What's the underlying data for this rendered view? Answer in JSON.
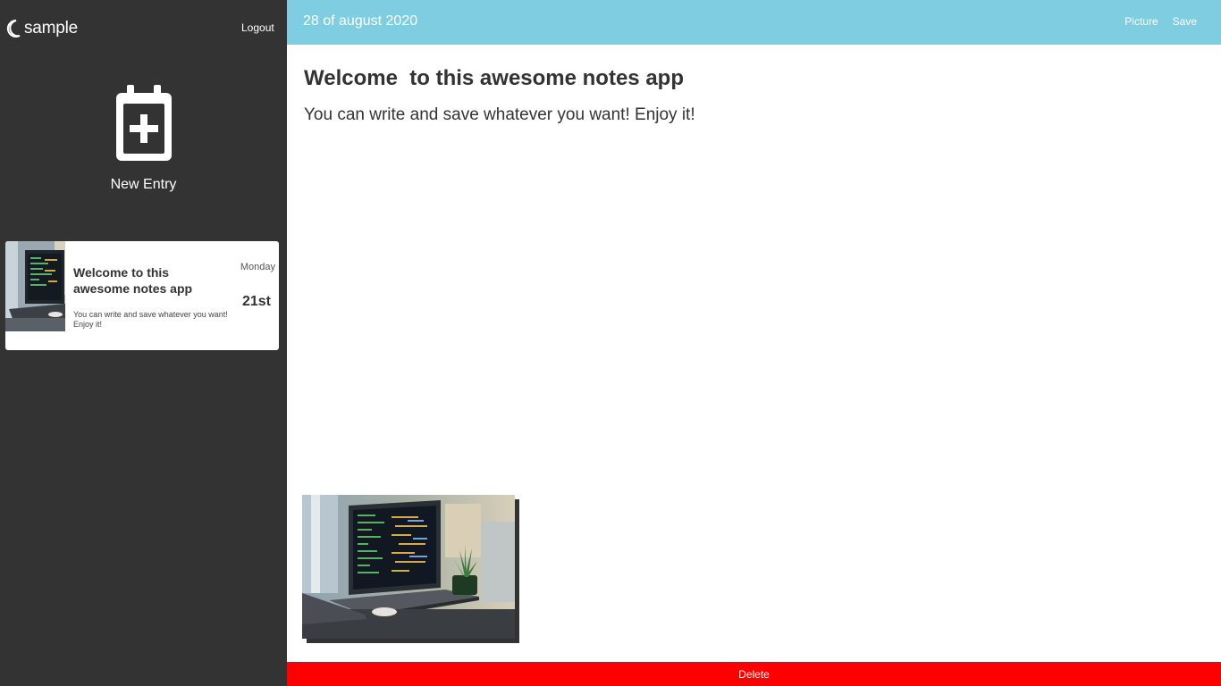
{
  "sidebar": {
    "brand": {
      "icon": "moon-icon",
      "name": "sample"
    },
    "logout_label": "Logout",
    "new_entry": {
      "icon": "calendar-plus-icon",
      "label": "New Entry"
    },
    "notes": [
      {
        "thumbnail": "laptop-photo",
        "title": "Welcome to this awesome notes app",
        "snippet": "You can write and save whatever you want! Enjoy it!",
        "day": "Monday",
        "date": "21st"
      }
    ]
  },
  "topbar": {
    "date": "28 of august 2020",
    "picture_label": "Picture",
    "save_label": "Save"
  },
  "entry": {
    "title": "Welcome  to this awesome notes app",
    "body": "You can write and save whatever you want! Enjoy it!",
    "image": "laptop-photo"
  },
  "delete_label": "Delete",
  "colors": {
    "sidebar_bg": "#333333",
    "topbar_bg": "#7ecde0",
    "delete_bg": "#ff0000",
    "text": "#333333"
  }
}
